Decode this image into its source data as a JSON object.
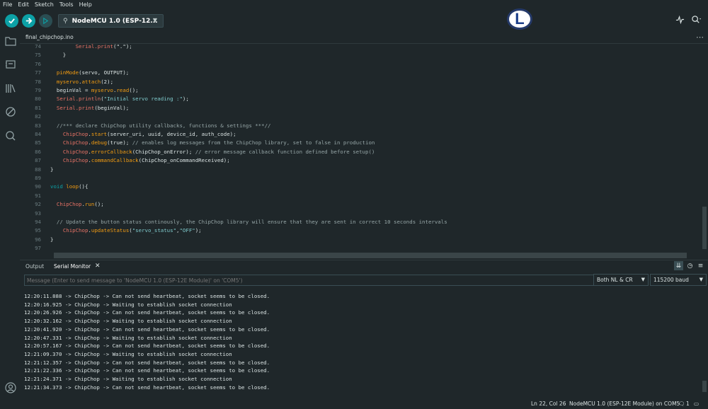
{
  "menu": {
    "items": [
      "File",
      "Edit",
      "Sketch",
      "Tools",
      "Help"
    ]
  },
  "toolbar": {
    "board_label": "NodeMCU 1.0 (ESP-12...",
    "avatar_letter": "L",
    "accent": "#0ca1a6"
  },
  "file_tab": {
    "name": "final_chipchop.ino",
    "more": "⋯"
  },
  "editor": {
    "lines": [
      {
        "n": "74",
        "segments": [
          {
            "t": "        ",
            "c": ""
          },
          {
            "t": "Serial.print",
            "c": "ser"
          },
          {
            "t": "(\".\");",
            "c": ""
          }
        ]
      },
      {
        "n": "75",
        "segments": [
          {
            "t": "    }",
            "c": ""
          }
        ]
      },
      {
        "n": "76",
        "segments": [
          {
            "t": "",
            "c": ""
          }
        ]
      },
      {
        "n": "77",
        "segments": [
          {
            "t": "  ",
            "c": ""
          },
          {
            "t": "pinMode",
            "c": "fn"
          },
          {
            "t": "(servo, OUTPUT);",
            "c": ""
          }
        ]
      },
      {
        "n": "78",
        "segments": [
          {
            "t": "  ",
            "c": ""
          },
          {
            "t": "myservo",
            "c": "fn"
          },
          {
            "t": ".",
            "c": ""
          },
          {
            "t": "attach",
            "c": "fn"
          },
          {
            "t": "(2);",
            "c": ""
          }
        ]
      },
      {
        "n": "79",
        "segments": [
          {
            "t": "  beginVal = ",
            "c": ""
          },
          {
            "t": "myservo",
            "c": "fn"
          },
          {
            "t": ".",
            "c": ""
          },
          {
            "t": "read",
            "c": "fn"
          },
          {
            "t": "();",
            "c": ""
          }
        ]
      },
      {
        "n": "80",
        "segments": [
          {
            "t": "  ",
            "c": ""
          },
          {
            "t": "Serial.println",
            "c": "ser"
          },
          {
            "t": "(",
            "c": ""
          },
          {
            "t": "\"Initial servo reading :\"",
            "c": "str"
          },
          {
            "t": ");",
            "c": ""
          }
        ]
      },
      {
        "n": "81",
        "segments": [
          {
            "t": "  ",
            "c": ""
          },
          {
            "t": "Serial.print",
            "c": "ser"
          },
          {
            "t": "(beginVal);",
            "c": ""
          }
        ]
      },
      {
        "n": "82",
        "segments": [
          {
            "t": "",
            "c": ""
          }
        ]
      },
      {
        "n": "83",
        "segments": [
          {
            "t": "  ",
            "c": ""
          },
          {
            "t": "//*** declare ChipChop utility callbacks, functions & settings ***//",
            "c": "cmt"
          }
        ]
      },
      {
        "n": "84",
        "segments": [
          {
            "t": "    ",
            "c": ""
          },
          {
            "t": "ChipChop",
            "c": "ser"
          },
          {
            "t": ".",
            "c": ""
          },
          {
            "t": "start",
            "c": "fn"
          },
          {
            "t": "(server_uri, uuid, device_id, auth_code);",
            "c": ""
          }
        ]
      },
      {
        "n": "85",
        "segments": [
          {
            "t": "    ",
            "c": ""
          },
          {
            "t": "ChipChop",
            "c": "ser"
          },
          {
            "t": ".",
            "c": ""
          },
          {
            "t": "debug",
            "c": "fn"
          },
          {
            "t": "(true); ",
            "c": ""
          },
          {
            "t": "// enables log messages from the ChipChop library, set to false in production",
            "c": "cmt"
          }
        ]
      },
      {
        "n": "86",
        "segments": [
          {
            "t": "    ",
            "c": ""
          },
          {
            "t": "ChipChop",
            "c": "ser"
          },
          {
            "t": ".",
            "c": ""
          },
          {
            "t": "errorCallback",
            "c": "fn"
          },
          {
            "t": "(ChipChop_onError); ",
            "c": ""
          },
          {
            "t": "// error message callback function defined before setup()",
            "c": "cmt"
          }
        ]
      },
      {
        "n": "87",
        "segments": [
          {
            "t": "    ",
            "c": ""
          },
          {
            "t": "ChipChop",
            "c": "ser"
          },
          {
            "t": ".",
            "c": ""
          },
          {
            "t": "commandCallback",
            "c": "fn"
          },
          {
            "t": "(ChipChop_onCommandReceived);",
            "c": ""
          }
        ]
      },
      {
        "n": "88",
        "segments": [
          {
            "t": "}",
            "c": ""
          }
        ]
      },
      {
        "n": "89",
        "segments": [
          {
            "t": "",
            "c": ""
          }
        ]
      },
      {
        "n": "90",
        "segments": [
          {
            "t": "void",
            "c": "kw"
          },
          {
            "t": " ",
            "c": ""
          },
          {
            "t": "loop",
            "c": "fn"
          },
          {
            "t": "(){",
            "c": ""
          }
        ]
      },
      {
        "n": "91",
        "segments": [
          {
            "t": "",
            "c": ""
          }
        ]
      },
      {
        "n": "92",
        "segments": [
          {
            "t": "  ",
            "c": ""
          },
          {
            "t": "ChipChop",
            "c": "ser"
          },
          {
            "t": ".",
            "c": ""
          },
          {
            "t": "run",
            "c": "fn"
          },
          {
            "t": "();",
            "c": ""
          }
        ]
      },
      {
        "n": "93",
        "segments": [
          {
            "t": "",
            "c": ""
          }
        ]
      },
      {
        "n": "94",
        "segments": [
          {
            "t": "  ",
            "c": ""
          },
          {
            "t": "// Update the button status continously, the ChipChop library will ensure that they are sent in correct 10 seconds intervals",
            "c": "cmt"
          }
        ]
      },
      {
        "n": "95",
        "segments": [
          {
            "t": "    ",
            "c": ""
          },
          {
            "t": "ChipChop",
            "c": "ser"
          },
          {
            "t": ".",
            "c": ""
          },
          {
            "t": "updateStatus",
            "c": "fn"
          },
          {
            "t": "(",
            "c": ""
          },
          {
            "t": "\"servo_status\"",
            "c": "str"
          },
          {
            "t": ",",
            "c": ""
          },
          {
            "t": "\"OFF\"",
            "c": "str"
          },
          {
            "t": ");",
            "c": ""
          }
        ]
      },
      {
        "n": "96",
        "segments": [
          {
            "t": "}",
            "c": ""
          }
        ]
      },
      {
        "n": "97",
        "segments": [
          {
            "t": "",
            "c": ""
          }
        ]
      }
    ]
  },
  "bottom_panel": {
    "tab_output": "Output",
    "tab_serial": "Serial Monitor",
    "tab_close": "✕",
    "message_placeholder": "Message (Enter to send message to 'NodeMCU 1.0 (ESP-12E Module)' on 'COM5')",
    "line_ending": "Both NL & CR",
    "baud": "115200 baud"
  },
  "monitor": {
    "lines": [
      "12:20:11.888 -> ChipChop -> Can not send heartbeat, socket seems to be closed.",
      "12:20:16.925 -> ChipChop -> Waiting to establish socket connection",
      "12:20:26.926 -> ChipChop -> Can not send heartbeat, socket seems to be closed.",
      "12:20:32.162 -> ChipChop -> Waiting to establish socket connection",
      "12:20:41.920 -> ChipChop -> Can not send heartbeat, socket seems to be closed.",
      "12:20:47.331 -> ChipChop -> Waiting to establish socket connection",
      "12:20:57.167 -> ChipChop -> Can not send heartbeat, socket seems to be closed.",
      "12:21:09.370 -> ChipChop -> Waiting to establish socket connection",
      "12:21:12.357 -> ChipChop -> Can not send heartbeat, socket seems to be closed.",
      "12:21:22.336 -> ChipChop -> Can not send heartbeat, socket seems to be closed.",
      "12:21:24.371 -> ChipChop -> Waiting to establish socket connection",
      "12:21:34.373 -> ChipChop -> Can not send heartbeat, socket seems to be closed."
    ]
  },
  "status": {
    "cursor": "Ln 22, Col 26",
    "board_port": "NodeMCU 1.0 (ESP-12E Module) on COM5",
    "notifications": "1"
  }
}
